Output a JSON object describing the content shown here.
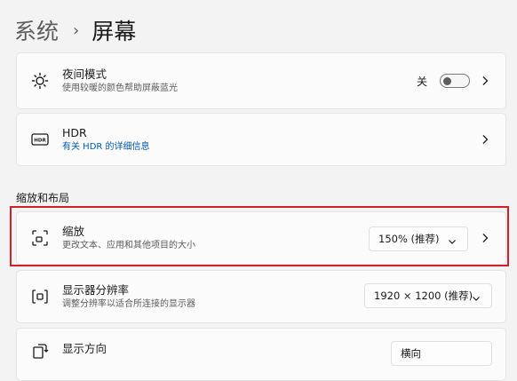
{
  "breadcrumb": {
    "parent": "系统",
    "separator": "›",
    "current": "屏幕"
  },
  "night_light": {
    "title": "夜间模式",
    "desc": "使用较暖的颜色帮助屏蔽蓝光",
    "toggle_label": "关",
    "icon": "sun-icon"
  },
  "hdr": {
    "title": "HDR",
    "link": "有关 HDR 的详细信息",
    "icon": "hdr-icon"
  },
  "section": {
    "label": "缩放和布局"
  },
  "scale": {
    "title": "缩放",
    "desc": "更改文本、应用和其他项目的大小",
    "value": "150% (推荐)",
    "icon": "scale-icon"
  },
  "resolution": {
    "title": "显示器分辨率",
    "desc": "调整分辨率以适合所连接的显示器",
    "value": "1920 × 1200 (推荐)",
    "icon": "resolution-icon"
  },
  "orientation": {
    "title": "显示方向",
    "value": "横向",
    "icon": "orientation-icon"
  },
  "colors": {
    "highlight": "#d0212a",
    "link": "#0058b0"
  }
}
